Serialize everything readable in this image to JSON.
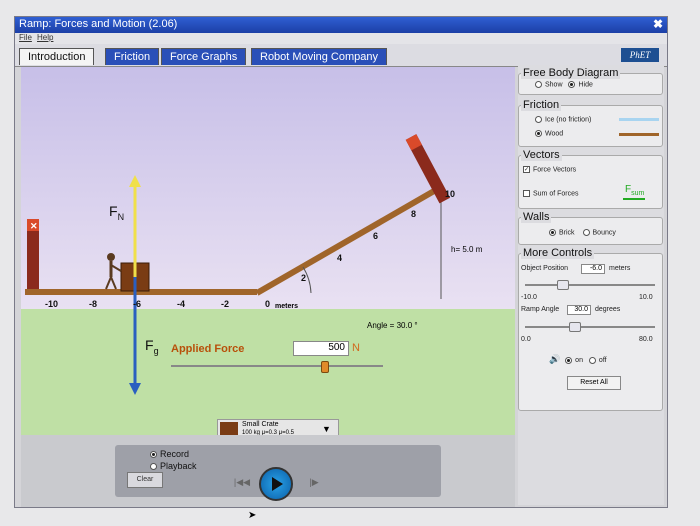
{
  "window": {
    "title": "Ramp: Forces and Motion (2.06)",
    "close_glyph": "✖"
  },
  "menu": {
    "file": "File",
    "help": "Help"
  },
  "tabs": [
    {
      "label": "Introduction",
      "selected": true
    },
    {
      "label": "Friction",
      "selected": false
    },
    {
      "label": "Force Graphs",
      "selected": false
    },
    {
      "label": "Robot Moving Company",
      "selected": false
    }
  ],
  "logo": "PhET",
  "scene": {
    "fn_label": "F",
    "fn_sub": "N",
    "fg_label": "F",
    "fg_sub": "g",
    "height_label": "h= 5.0 m",
    "angle_label": "Angle = 30.0 °",
    "meters_label": "meters",
    "ground_ticks": [
      "-10",
      "-8",
      "-6",
      "-4",
      "-2",
      "0"
    ],
    "ramp_ticks": [
      "2",
      "4",
      "6",
      "8",
      "10"
    ],
    "applied_force_label": "Applied Force",
    "applied_force_value": "500",
    "applied_force_unit": "N",
    "applied_force_fraction": 0.72,
    "crate": {
      "name": "Small Crate",
      "desc": "100 kg μ=0.3 μ=0.5"
    }
  },
  "controls": {
    "clear": "Clear",
    "record": "Record",
    "playback": "Playback",
    "mode": "record"
  },
  "side": {
    "free_body": {
      "title": "Free Body Diagram",
      "show": "Show",
      "hide": "Hide",
      "selected": "hide"
    },
    "friction": {
      "title": "Friction",
      "ice": "Ice (no friction)",
      "wood": "Wood",
      "selected": "wood",
      "ice_color": "#a8d4f0",
      "wood_color": "#a0652a"
    },
    "vectors": {
      "title": "Vectors",
      "force_vectors": "Force Vectors",
      "force_checked": true,
      "sum_of_forces": "Sum of Forces",
      "sum_checked": false,
      "fsum_label": "F",
      "fsum_sub": "sum"
    },
    "walls": {
      "title": "Walls",
      "brick": "Brick",
      "bouncy": "Bouncy",
      "selected": "brick"
    },
    "more": {
      "title": "More Controls",
      "object_position_label": "Object Position",
      "object_position_value": "-6.0",
      "object_position_unit": "meters",
      "pos_min": "-10.0",
      "pos_max": "10.0",
      "ramp_angle_label": "Ramp Angle",
      "ramp_angle_value": "30.0",
      "ramp_angle_unit": "degrees",
      "angle_min": "0.0",
      "angle_max": "80.0",
      "sound_on": "on",
      "sound_off": "off",
      "sound_selected": "on",
      "reset": "Reset All"
    }
  }
}
